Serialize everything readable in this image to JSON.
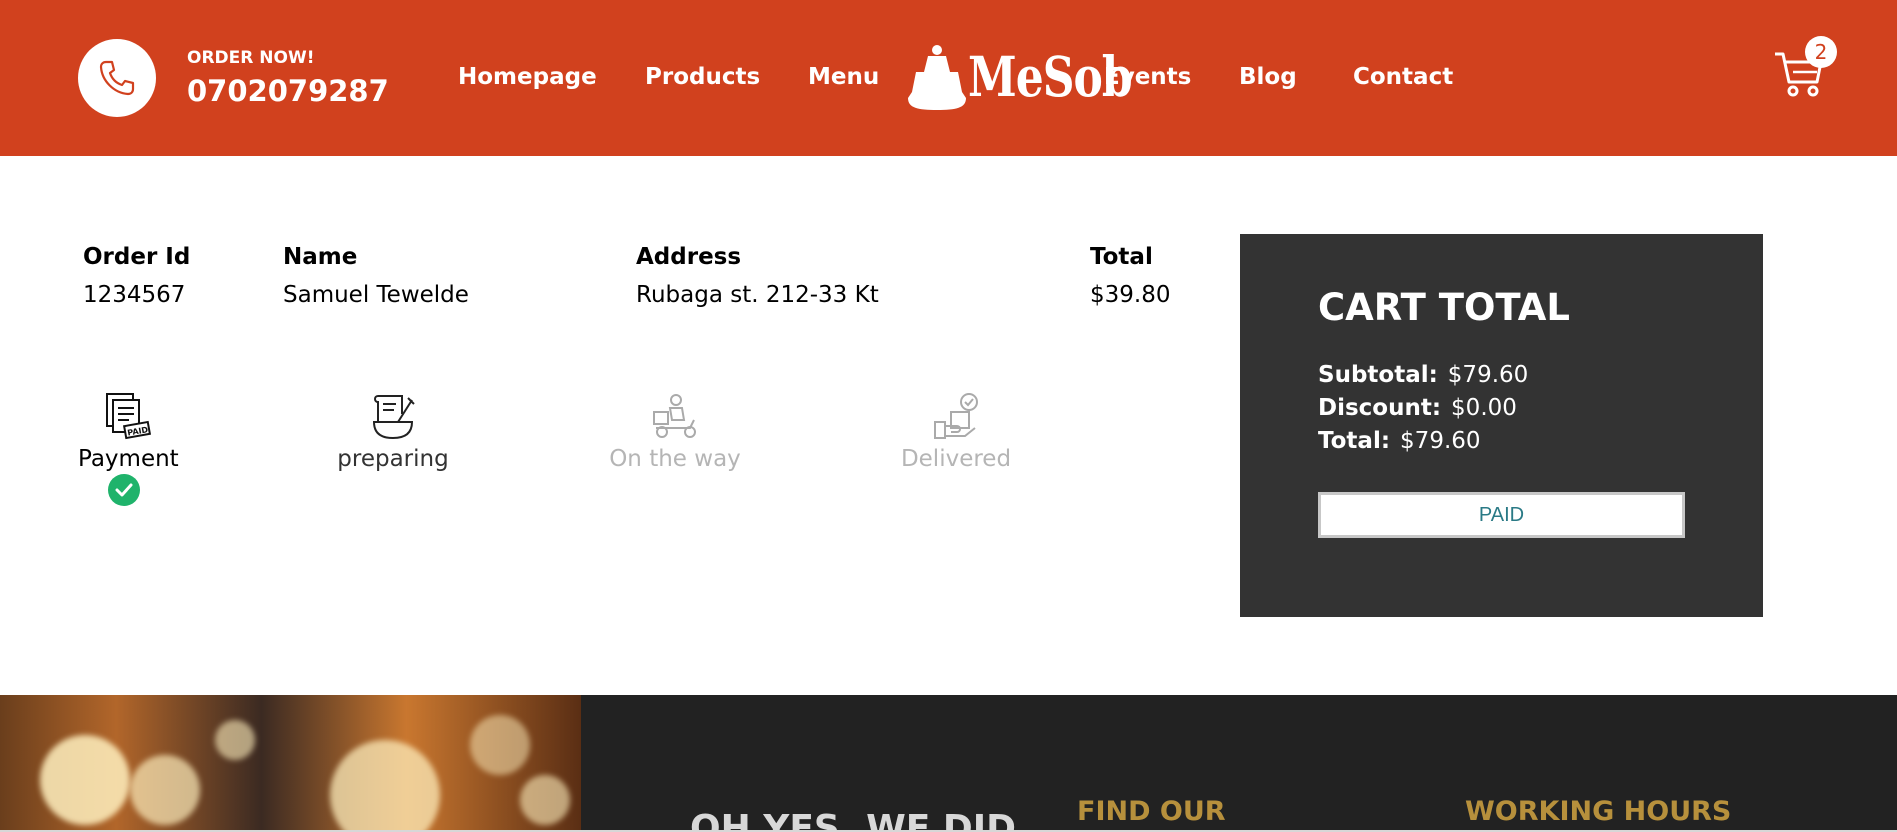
{
  "header": {
    "order_now": "ORDER NOW!",
    "phone": "0702079287",
    "nav_left": [
      "Homepage",
      "Products",
      "Menu"
    ],
    "logo_text": "MeSob",
    "nav_right": [
      "Events",
      "Blog",
      "Contact"
    ],
    "cart_count": "2"
  },
  "order": {
    "headers": {
      "order_id": "Order Id",
      "name": "Name",
      "address": "Address",
      "total": "Total"
    },
    "values": {
      "order_id": "1234567",
      "name": "Samuel Tewelde",
      "address": "Rubaga st. 212-33 Kt",
      "total": "$39.80"
    }
  },
  "status": {
    "steps": [
      {
        "label": "Payment",
        "state": "done",
        "icon": "paid-document-icon"
      },
      {
        "label": "preparing",
        "state": "inprogress",
        "icon": "cooking-recipe-icon"
      },
      {
        "label": "On the way",
        "state": "pending",
        "icon": "delivery-scooter-icon"
      },
      {
        "label": "Delivered",
        "state": "pending",
        "icon": "delivered-package-icon"
      }
    ]
  },
  "cart_total": {
    "title": "CART TOTAL",
    "subtotal_label": "Subtotal:",
    "subtotal": "$79.60",
    "discount_label": "Discount:",
    "discount": "$0.00",
    "total_label": "Total:",
    "total": "$79.60",
    "button": "PAID"
  },
  "footer": {
    "motto": "OH YES, WE DID",
    "find_heading": "FIND OUR",
    "hours_heading": "WORKING HOURS"
  },
  "colors": {
    "brand_red": "#d1411e",
    "dark_panel": "#333333",
    "footer_dark": "#222222",
    "accent_gold": "#b7903c",
    "check_green": "#1fb36b"
  }
}
